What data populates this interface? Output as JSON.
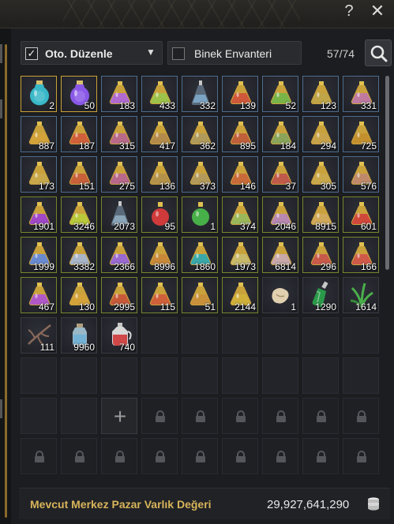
{
  "window": {
    "help_label": "?",
    "close_label": "✕"
  },
  "toolbar": {
    "auto_arrange_checked": true,
    "auto_arrange_label": "Oto. Düzenle",
    "mount_inventory_checked": false,
    "mount_inventory_label": "Binek Envanteri",
    "capacity": "57/74",
    "search_icon": "search-icon"
  },
  "grid": {
    "columns": 9,
    "slots": [
      {
        "state": "item",
        "border": "gold",
        "icon": "potion-teal-icon",
        "color": "#39b8c8",
        "qty": "2"
      },
      {
        "state": "item",
        "border": "gold",
        "icon": "potion-violet-icon",
        "color": "#8a58e8",
        "qty": "50"
      },
      {
        "state": "item",
        "border": "blue",
        "icon": "elixir-flask-icon",
        "color": "#b06ad0",
        "qty": "183"
      },
      {
        "state": "item",
        "border": "blue",
        "icon": "elixir-flask-icon",
        "color": "#9dc24a",
        "qty": "433"
      },
      {
        "state": "item",
        "border": "blue",
        "icon": "elixir-vial-icon",
        "color": "#7ba4c4",
        "qty": "332"
      },
      {
        "state": "item",
        "border": "blue",
        "icon": "elixir-flask-icon",
        "color": "#d0583a",
        "qty": "139"
      },
      {
        "state": "item",
        "border": "blue",
        "icon": "elixir-flask-icon",
        "color": "#78b448",
        "qty": "52"
      },
      {
        "state": "item",
        "border": "blue",
        "icon": "elixir-flask-icon",
        "color": "#bfa448",
        "qty": "123"
      },
      {
        "state": "item",
        "border": "blue",
        "icon": "elixir-flask-icon",
        "color": "#c07aa0",
        "qty": "331"
      },
      {
        "state": "item",
        "border": "blue",
        "icon": "elixir-flask-icon",
        "color": "#d4a23a",
        "qty": "887"
      },
      {
        "state": "item",
        "border": "blue",
        "icon": "elixir-flask-icon",
        "color": "#d0603a",
        "qty": "187"
      },
      {
        "state": "item",
        "border": "blue",
        "icon": "elixir-flask-icon",
        "color": "#b86a88",
        "qty": "315"
      },
      {
        "state": "item",
        "border": "blue",
        "icon": "elixir-flask-icon",
        "color": "#b48a4a",
        "qty": "417"
      },
      {
        "state": "item",
        "border": "blue",
        "icon": "elixir-flask-icon",
        "color": "#b09a5a",
        "qty": "362"
      },
      {
        "state": "item",
        "border": "blue",
        "icon": "elixir-flask-icon",
        "color": "#c0603a",
        "qty": "895"
      },
      {
        "state": "item",
        "border": "blue",
        "icon": "elixir-flask-icon",
        "color": "#8aa45a",
        "qty": "184"
      },
      {
        "state": "item",
        "border": "blue",
        "icon": "elixir-flask-icon",
        "color": "#c8a24a",
        "qty": "294"
      },
      {
        "state": "item",
        "border": "blue",
        "icon": "elixir-flask-icon",
        "color": "#c4902e",
        "qty": "725"
      },
      {
        "state": "item",
        "border": "blue",
        "icon": "elixir-flask-icon",
        "color": "#c8a84a",
        "qty": "173"
      },
      {
        "state": "item",
        "border": "blue",
        "icon": "elixir-flask-icon",
        "color": "#c8603a",
        "qty": "151"
      },
      {
        "state": "item",
        "border": "blue",
        "icon": "elixir-flask-icon",
        "color": "#b8688a",
        "qty": "275"
      },
      {
        "state": "item",
        "border": "blue",
        "icon": "elixir-flask-icon",
        "color": "#b4924a",
        "qty": "136"
      },
      {
        "state": "item",
        "border": "blue",
        "icon": "elixir-flask-icon",
        "color": "#b49a5a",
        "qty": "373"
      },
      {
        "state": "item",
        "border": "blue",
        "icon": "elixir-flask-icon",
        "color": "#c86a3a",
        "qty": "146"
      },
      {
        "state": "item",
        "border": "blue",
        "icon": "elixir-flask-icon",
        "color": "#c05a4a",
        "qty": "37"
      },
      {
        "state": "item",
        "border": "blue",
        "icon": "elixir-flask-icon",
        "color": "#c8a84a",
        "qty": "305"
      },
      {
        "state": "item",
        "border": "blue",
        "icon": "elixir-flask-icon",
        "color": "#c08a6a",
        "qty": "576"
      },
      {
        "state": "item",
        "border": "green",
        "icon": "elixir-flask-icon",
        "color": "#a048c8",
        "qty": "1901"
      },
      {
        "state": "item",
        "border": "green",
        "icon": "elixir-flask-icon",
        "color": "#b8c83a",
        "qty": "3246"
      },
      {
        "state": "item",
        "border": "green",
        "icon": "elixir-vial-icon",
        "color": "#8aa4b8",
        "qty": "2073"
      },
      {
        "state": "item",
        "border": "green",
        "icon": "elixir-round-icon",
        "color": "#d03a3a",
        "qty": "95"
      },
      {
        "state": "item",
        "border": "green",
        "icon": "elixir-round-icon",
        "color": "#48b048",
        "qty": "1"
      },
      {
        "state": "item",
        "border": "green",
        "icon": "elixir-flask-icon",
        "color": "#9ab85a",
        "qty": "374"
      },
      {
        "state": "item",
        "border": "green",
        "icon": "elixir-flask-icon",
        "color": "#b888b0",
        "qty": "2046"
      },
      {
        "state": "item",
        "border": "green",
        "icon": "elixir-flask-icon",
        "color": "#d0a85a",
        "qty": "8915"
      },
      {
        "state": "item",
        "border": "green",
        "icon": "elixir-flask-icon",
        "color": "#d0483a",
        "qty": "601"
      },
      {
        "state": "item",
        "border": "green",
        "icon": "elixir-flask-icon",
        "color": "#6a8ad0",
        "qty": "1999"
      },
      {
        "state": "item",
        "border": "green",
        "icon": "elixir-flask-icon",
        "color": "#a8b4c8",
        "qty": "3382"
      },
      {
        "state": "item",
        "border": "green",
        "icon": "elixir-flask-icon",
        "color": "#9a6ad0",
        "qty": "2366"
      },
      {
        "state": "item",
        "border": "green",
        "icon": "elixir-flask-icon",
        "color": "#c8883a",
        "qty": "8996"
      },
      {
        "state": "item",
        "border": "green",
        "icon": "elixir-flask-icon",
        "color": "#3aa8a8",
        "qty": "1860"
      },
      {
        "state": "item",
        "border": "green",
        "icon": "elixir-flask-icon",
        "color": "#c8b86a",
        "qty": "1973"
      },
      {
        "state": "item",
        "border": "green",
        "icon": "elixir-flask-icon",
        "color": "#c8a8a8",
        "qty": "6814"
      },
      {
        "state": "item",
        "border": "green",
        "icon": "elixir-flask-icon",
        "color": "#c85a4a",
        "qty": "296"
      },
      {
        "state": "item",
        "border": "green",
        "icon": "elixir-flask-icon",
        "color": "#d05a4a",
        "qty": "166"
      },
      {
        "state": "item",
        "border": "green",
        "icon": "elixir-flask-icon",
        "color": "#b058c8",
        "qty": "467"
      },
      {
        "state": "item",
        "border": "green",
        "icon": "elixir-flask-icon",
        "color": "#d4a23a",
        "qty": "130"
      },
      {
        "state": "item",
        "border": "green",
        "icon": "elixir-flask-icon",
        "color": "#c85a3a",
        "qty": "2995"
      },
      {
        "state": "item",
        "border": "green",
        "icon": "elixir-flask-icon",
        "color": "#d0603a",
        "qty": "115"
      },
      {
        "state": "item",
        "border": "green",
        "icon": "elixir-flask-icon",
        "color": "#c8903a",
        "qty": "51"
      },
      {
        "state": "item",
        "border": "green",
        "icon": "elixir-flask-icon",
        "color": "#d0b03a",
        "qty": "2144"
      },
      {
        "state": "item",
        "border": "none",
        "icon": "ginseng-root-icon",
        "color": "#e0d0b0",
        "qty": "1"
      },
      {
        "state": "item",
        "border": "none",
        "icon": "green-bottle-icon",
        "color": "#2a9a4a",
        "qty": "1290"
      },
      {
        "state": "item",
        "border": "none",
        "icon": "grass-herb-icon",
        "color": "#4ab04a",
        "qty": "1614"
      },
      {
        "state": "item",
        "border": "none",
        "icon": "dry-branch-icon",
        "color": "#8a6a5a",
        "qty": "111"
      },
      {
        "state": "item",
        "border": "none",
        "icon": "water-bottle-icon",
        "color": "#6ab0d8",
        "qty": "9960"
      },
      {
        "state": "item",
        "border": "none",
        "icon": "red-jug-icon",
        "color": "#d04848",
        "qty": "740"
      },
      {
        "state": "empty"
      },
      {
        "state": "empty"
      },
      {
        "state": "empty"
      },
      {
        "state": "empty"
      },
      {
        "state": "empty"
      },
      {
        "state": "empty"
      },
      {
        "state": "empty"
      },
      {
        "state": "empty"
      },
      {
        "state": "empty"
      },
      {
        "state": "empty"
      },
      {
        "state": "empty"
      },
      {
        "state": "empty"
      },
      {
        "state": "empty"
      },
      {
        "state": "empty"
      },
      {
        "state": "empty"
      },
      {
        "state": "empty"
      },
      {
        "state": "empty"
      },
      {
        "state": "add"
      },
      {
        "state": "locked"
      },
      {
        "state": "locked"
      },
      {
        "state": "locked"
      },
      {
        "state": "locked"
      },
      {
        "state": "locked"
      },
      {
        "state": "locked"
      },
      {
        "state": "locked"
      },
      {
        "state": "locked"
      },
      {
        "state": "locked"
      },
      {
        "state": "locked"
      },
      {
        "state": "locked"
      },
      {
        "state": "locked"
      },
      {
        "state": "locked"
      },
      {
        "state": "locked"
      },
      {
        "state": "locked"
      }
    ],
    "add_label": "+"
  },
  "footer": {
    "label": "Mevcut Merkez Pazar Varlık Değeri",
    "value": "29,927,641,290",
    "icon": "coin-stack-icon"
  },
  "colors": {
    "accent_gold": "#d8b45a",
    "border_gold": "#c9a23a",
    "border_blue": "#4d6c8e",
    "border_green": "#76862e"
  }
}
